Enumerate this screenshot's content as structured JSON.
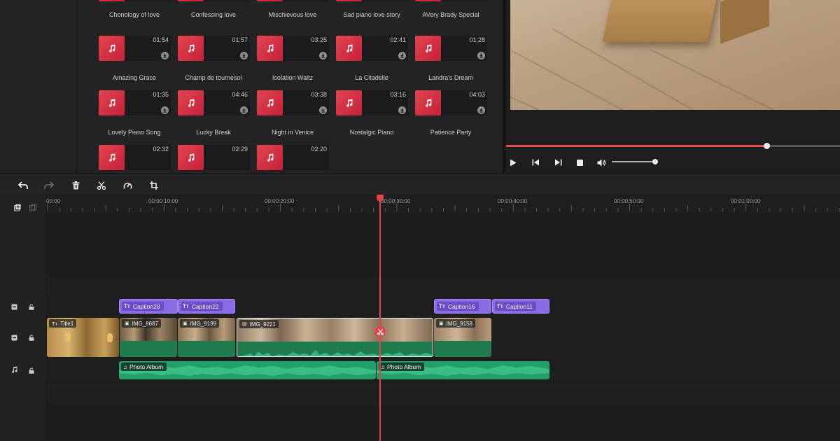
{
  "media": {
    "items": [
      {
        "name": "Chonology of love",
        "duration": ""
      },
      {
        "name": "Confessing love",
        "duration": ""
      },
      {
        "name": "Mischievous love",
        "duration": ""
      },
      {
        "name": "Sad piano love story",
        "duration": ""
      },
      {
        "name": "AVery Brady Special",
        "duration": ""
      },
      {
        "name": "Amazing Grace",
        "duration": "01:54"
      },
      {
        "name": "Champ de tournesol",
        "duration": "01:57"
      },
      {
        "name": "Isolation Waltz",
        "duration": "03:25"
      },
      {
        "name": "La Citadelle",
        "duration": "02:41"
      },
      {
        "name": "Landra's Dream",
        "duration": "01:28"
      },
      {
        "name": "Lovely Piano Song",
        "duration": "01:35"
      },
      {
        "name": "Lucky Break",
        "duration": "04:46"
      },
      {
        "name": "Night in Venice",
        "duration": "03:38"
      },
      {
        "name": "Nostalgic Piano",
        "duration": "03:16"
      },
      {
        "name": "Patience Party",
        "duration": "04:03"
      },
      {
        "name": "",
        "duration": "02:32"
      },
      {
        "name": "",
        "duration": "02:29"
      },
      {
        "name": "",
        "duration": "02:20"
      }
    ]
  },
  "player": {
    "progress": 0.78,
    "volume": 0.95,
    "controls": [
      "play-icon",
      "prev-frame-icon",
      "next-frame-icon",
      "stop-icon",
      "volume-icon"
    ]
  },
  "toolbar": {
    "icons": [
      "undo-icon",
      "redo-icon",
      "delete-icon",
      "cut-icon",
      "speed-icon",
      "crop-icon"
    ]
  },
  "timeline": {
    "ruler_labels": [
      "00:00",
      "00:00:10:00",
      "00:00:20:00",
      "00:00:30:00",
      "00:00:40:00",
      "00:00:50:00",
      "00:01:00:00"
    ],
    "captions": [
      {
        "label": "Caption28"
      },
      {
        "label": "Caption22"
      },
      {
        "label": "Caption16"
      },
      {
        "label": "Caption11"
      }
    ],
    "video_clips": [
      {
        "label": "Title1"
      },
      {
        "label": "IMG_8687"
      },
      {
        "label": "IMG_9199"
      },
      {
        "label": "IMG_9221"
      },
      {
        "label": "IMG_9158"
      }
    ],
    "audio_clips": [
      {
        "label": "Photo Album"
      },
      {
        "label": "Photo Album"
      }
    ]
  },
  "colors": {
    "accent": "#e3434b",
    "caption": "#8b6ae6",
    "audio": "#23a06a",
    "media_tile": "#d8313f"
  }
}
